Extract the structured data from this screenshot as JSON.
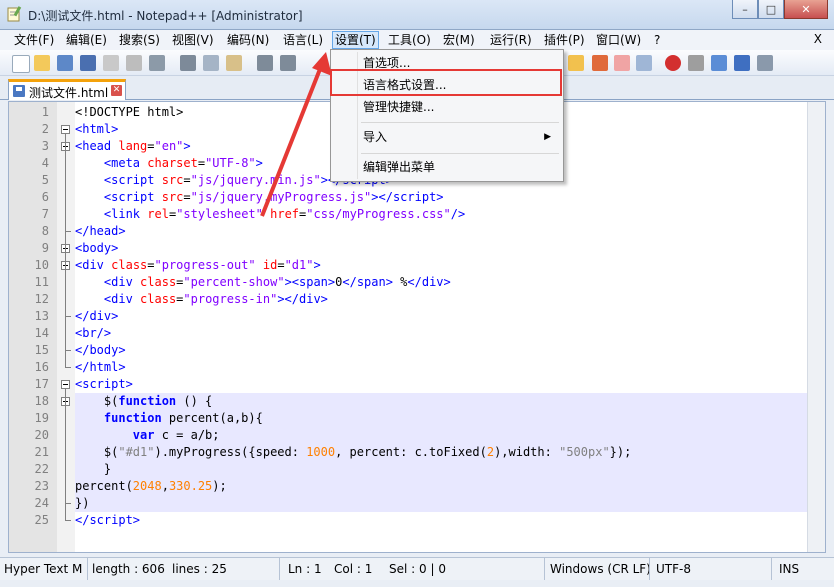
{
  "window": {
    "title": "D:\\测试文件.html - Notepad++ [Administrator]",
    "minimize": "–",
    "maximize": "□",
    "close": "✕"
  },
  "menu": {
    "items": [
      "文件(F)",
      "编辑(E)",
      "搜索(S)",
      "视图(V)",
      "编码(N)",
      "语言(L)",
      "设置(T)",
      "工具(O)",
      "宏(M)",
      "运行(R)",
      "插件(P)",
      "窗口(W)",
      "?"
    ],
    "close": "X"
  },
  "dropdown": {
    "items": [
      "首选项...",
      "语言格式设置...",
      "管理快捷键...",
      "导入",
      "编辑弹出菜单"
    ],
    "submenu_arrow": "▶"
  },
  "tab": {
    "label": "测试文件.html",
    "close": "✕"
  },
  "editor": {
    "lines": [
      {
        "n": "1",
        "h": "&lt;!DOCTYPE html&gt;"
      },
      {
        "n": "2",
        "h": "<span class=\"tag\">&lt;html&gt;</span>"
      },
      {
        "n": "3",
        "h": "<span class=\"tag\">&lt;head</span> <span class=\"attr\">lang</span>=<span class=\"val\">\"en\"</span><span class=\"tag\">&gt;</span>"
      },
      {
        "n": "4",
        "h": "    <span class=\"tag\">&lt;meta</span> <span class=\"attr\">charset</span>=<span class=\"val\">\"UTF-8\"</span><span class=\"tag\">&gt;</span>"
      },
      {
        "n": "5",
        "h": "    <span class=\"tag\">&lt;script</span> <span class=\"attr\">src</span>=<span class=\"val\">\"js/jquery.min.js\"</span><span class=\"tag\">&gt;&lt;/script&gt;</span>"
      },
      {
        "n": "6",
        "h": "    <span class=\"tag\">&lt;script</span> <span class=\"attr\">src</span>=<span class=\"val\">\"js/jquery.myProgress.js\"</span><span class=\"tag\">&gt;&lt;/script&gt;</span>"
      },
      {
        "n": "7",
        "h": "    <span class=\"tag\">&lt;link</span> <span class=\"attr\">rel</span>=<span class=\"val\">\"stylesheet\"</span> <span class=\"attr\">href</span>=<span class=\"val\">\"css/myProgress.css\"</span><span class=\"tag\">/&gt;</span>"
      },
      {
        "n": "8",
        "h": "<span class=\"tag\">&lt;/head&gt;</span>"
      },
      {
        "n": "9",
        "h": "<span class=\"tag\">&lt;body&gt;</span>"
      },
      {
        "n": "10",
        "h": "<span class=\"tag\">&lt;div</span> <span class=\"attr\">class</span>=<span class=\"val\">\"progress-out\"</span> <span class=\"attr\">id</span>=<span class=\"val\">\"d1\"</span><span class=\"tag\">&gt;</span>"
      },
      {
        "n": "11",
        "h": "    <span class=\"tag\">&lt;div</span> <span class=\"attr\">class</span>=<span class=\"val\">\"percent-show\"</span><span class=\"tag\">&gt;&lt;span&gt;</span>0<span class=\"tag\">&lt;/span&gt;</span> %<span class=\"tag\">&lt;/div&gt;</span>"
      },
      {
        "n": "12",
        "h": "    <span class=\"tag\">&lt;div</span> <span class=\"attr\">class</span>=<span class=\"val\">\"progress-in\"</span><span class=\"tag\">&gt;&lt;/div&gt;</span>"
      },
      {
        "n": "13",
        "h": "<span class=\"tag\">&lt;/div&gt;</span>"
      },
      {
        "n": "14",
        "h": "<span class=\"tag\">&lt;br/&gt;</span>"
      },
      {
        "n": "15",
        "h": "<span class=\"tag\">&lt;/body&gt;</span>"
      },
      {
        "n": "16",
        "h": "<span class=\"tag\">&lt;/html&gt;</span>"
      },
      {
        "n": "17",
        "h": "<span class=\"tag\">&lt;script&gt;</span>"
      },
      {
        "n": "18",
        "h": "    $(<span class=\"kw\">function</span> () {",
        "hl": true
      },
      {
        "n": "19",
        "h": "    <span class=\"kw\">function</span> percent(a,b){",
        "hl": true
      },
      {
        "n": "20",
        "h": "        <span class=\"kw\">var</span> c = a/b;",
        "hl": true
      },
      {
        "n": "21",
        "h": "    $(<span class=\"str\">\"#d1\"</span>).myProgress({speed: <span class=\"num\">1000</span>, percent: c.toFixed(<span class=\"num\">2</span>),width: <span class=\"str\">\"500px\"</span>});",
        "hl": true
      },
      {
        "n": "22",
        "h": "    }",
        "hl": true
      },
      {
        "n": "23",
        "h": "percent(<span class=\"num\">2048</span>,<span class=\"num\">330.25</span>);",
        "hl": true
      },
      {
        "n": "24",
        "h": "})",
        "hl": true
      },
      {
        "n": "25",
        "h": "<span class=\"tag\">&lt;/script&gt;</span>"
      }
    ]
  },
  "status": {
    "lang": "Hyper Text M",
    "length": "length : 606",
    "lines": "lines : 25",
    "ln": "Ln : 1",
    "col": "Col : 1",
    "sel": "Sel : 0 | 0",
    "eol": "Windows (CR LF)",
    "enc": "UTF-8",
    "mode": "INS"
  },
  "colors": {
    "annotation": "#e53935",
    "accent": "#f4a20b"
  }
}
